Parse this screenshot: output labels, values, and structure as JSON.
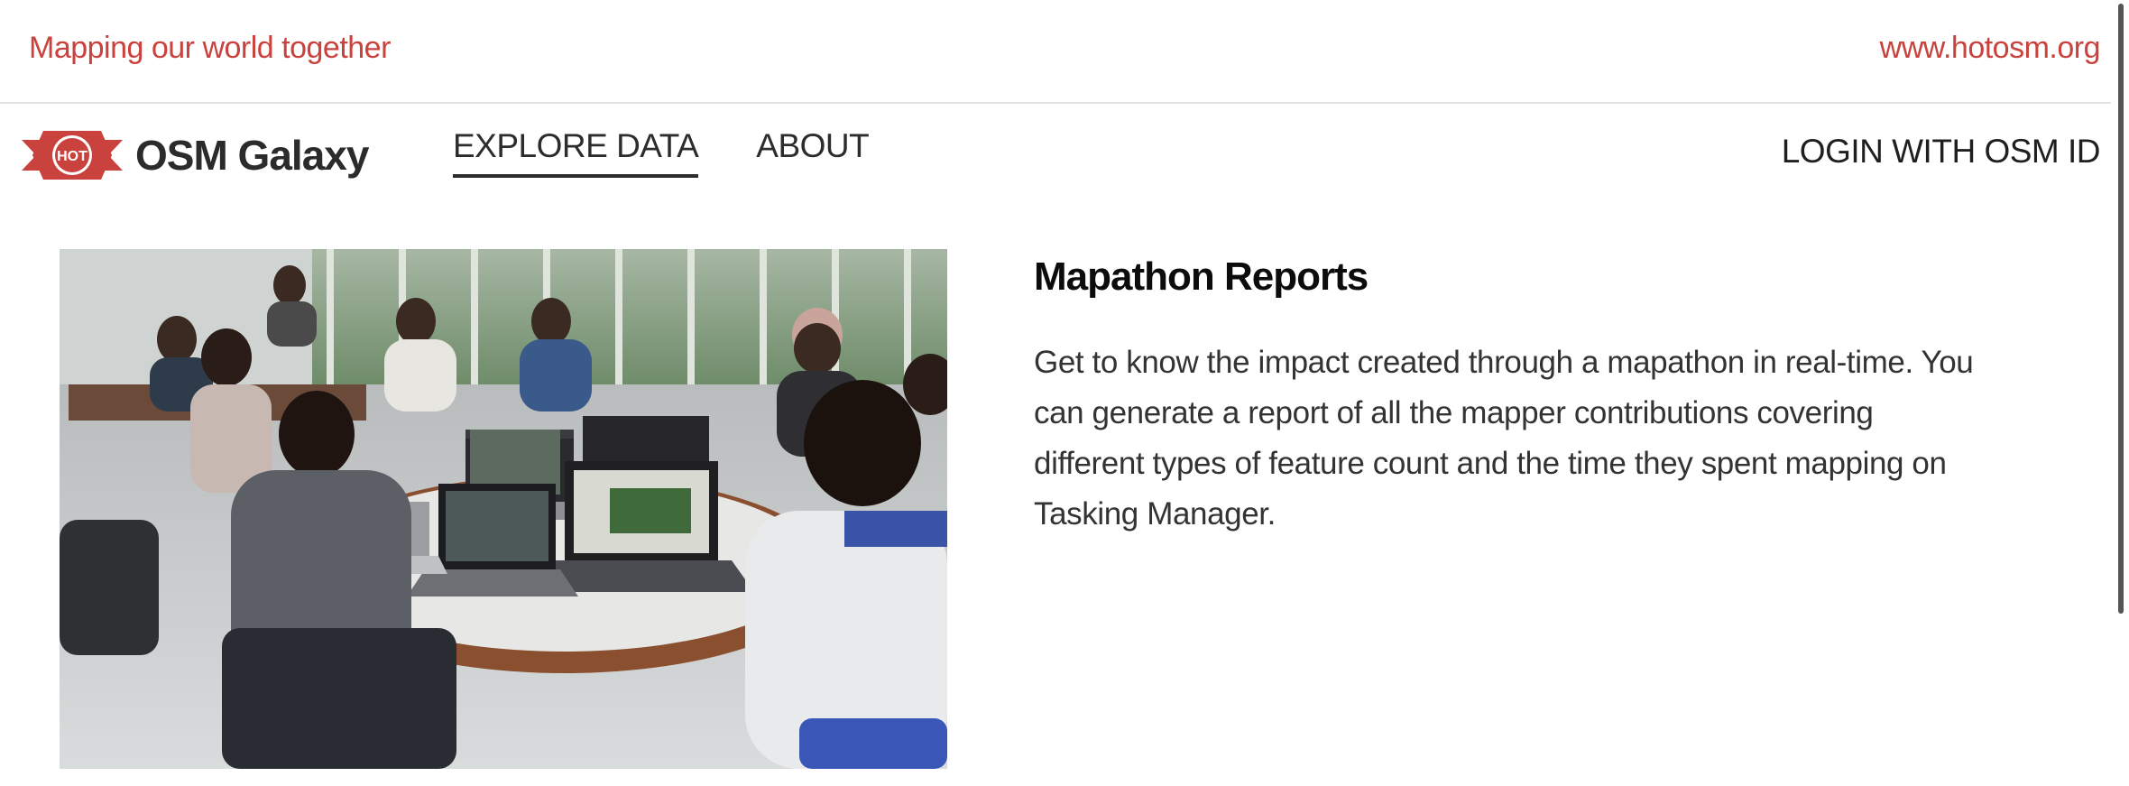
{
  "top_strip": {
    "tagline": "Mapping our world together",
    "site_link": "www.hotosm.org"
  },
  "header": {
    "logo_text": "HOT",
    "app_name": "OSM Galaxy",
    "nav": [
      {
        "label": "EXPLORE DATA",
        "active": true
      },
      {
        "label": "ABOUT",
        "active": false
      }
    ],
    "login_label": "LOGIN WITH OSM ID"
  },
  "content": {
    "title": "Mapathon Reports",
    "description": "Get to know the impact created through a mapathon in real-time. You can generate a report of all the mapper contributions covering different types of feature count and the time they spent mapping on Tasking Manager."
  },
  "colors": {
    "brand_red": "#c9423d",
    "text_dark": "#2c2c2c"
  },
  "icons": {
    "logo": "hot-logo-icon"
  }
}
